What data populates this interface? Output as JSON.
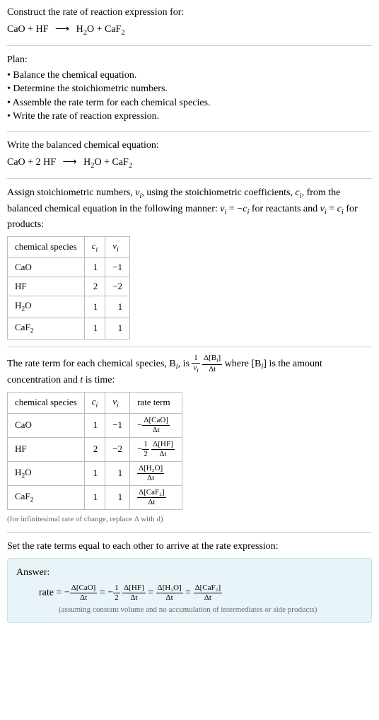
{
  "header": {
    "prompt": "Construct the rate of reaction expression for:",
    "reaction_lhs_1": "CaO",
    "reaction_lhs_2": "HF",
    "reaction_rhs_1_base": "H",
    "reaction_rhs_1_sub": "2",
    "reaction_rhs_1_tail": "O",
    "reaction_rhs_2_base": "CaF",
    "reaction_rhs_2_sub": "2"
  },
  "plan": {
    "label": "Plan:",
    "items": [
      "Balance the chemical equation.",
      "Determine the stoichiometric numbers.",
      "Assemble the rate term for each chemical species.",
      "Write the rate of reaction expression."
    ]
  },
  "balanced": {
    "intro": "Write the balanced chemical equation:",
    "lhs_1": "CaO",
    "lhs_2_coef": "2",
    "lhs_2": "HF",
    "rhs_1_base": "H",
    "rhs_1_sub": "2",
    "rhs_1_tail": "O",
    "rhs_2_base": "CaF",
    "rhs_2_sub": "2"
  },
  "stoich": {
    "intro_1": "Assign stoichiometric numbers, ",
    "nu_i": "ν",
    "i_sub": "i",
    "intro_2": ", using the stoichiometric coefficients, ",
    "c_i": "c",
    "intro_3": ", from the balanced chemical equation in the following manner: ",
    "rel1": " = −",
    "intro_4": " for reactants and ",
    "rel2": " = ",
    "intro_5": " for products:",
    "headers": {
      "species": "chemical species",
      "c": "c",
      "nu": "ν",
      "i": "i"
    },
    "rows": [
      {
        "species": "CaO",
        "c": "1",
        "nu": "−1"
      },
      {
        "species": "HF",
        "c": "2",
        "nu": "−2"
      },
      {
        "species_base": "H",
        "species_sub": "2",
        "species_tail": "O",
        "c": "1",
        "nu": "1"
      },
      {
        "species_base": "CaF",
        "species_sub": "2",
        "species_tail": "",
        "c": "1",
        "nu": "1"
      }
    ]
  },
  "rateterm": {
    "intro_1": "The rate term for each chemical species, B",
    "i_sub": "i",
    "intro_2": ", is ",
    "frac1_top": "1",
    "frac1_bot_nu": "ν",
    "frac2_top_delta": "Δ[B",
    "frac2_top_close": "]",
    "frac2_bot": "Δt",
    "intro_3": " where [B",
    "intro_4": "] is the amount concentration and ",
    "t": "t",
    "intro_5": " is time:",
    "headers": {
      "species": "chemical species",
      "c": "c",
      "nu": "ν",
      "i": "i",
      "rate": "rate term"
    },
    "rows": [
      {
        "species": "CaO",
        "c": "1",
        "nu": "−1",
        "neg": "−",
        "coef_top": "",
        "coef_bot": "",
        "top": "Δ[CaO]",
        "bot": "Δt"
      },
      {
        "species": "HF",
        "c": "2",
        "nu": "−2",
        "neg": "−",
        "coef_top": "1",
        "coef_bot": "2",
        "top": "Δ[HF]",
        "bot": "Δt"
      },
      {
        "species_base": "H",
        "species_sub": "2",
        "species_tail": "O",
        "c": "1",
        "nu": "1",
        "neg": "",
        "coef_top": "",
        "coef_bot": "",
        "top": "Δ[H₂O]",
        "bot": "Δt"
      },
      {
        "species_base": "CaF",
        "species_sub": "2",
        "species_tail": "",
        "c": "1",
        "nu": "1",
        "neg": "",
        "coef_top": "",
        "coef_bot": "",
        "top": "Δ[CaF₂]",
        "bot": "Δt"
      }
    ],
    "note": "(for infinitesimal rate of change, replace Δ with d)"
  },
  "final": {
    "intro": "Set the rate terms equal to each other to arrive at the rate expression:",
    "answer_label": "Answer:",
    "rate_label": "rate = ",
    "neg": "−",
    "t1_top": "Δ[CaO]",
    "t1_bot": "Δt",
    "eq": " = ",
    "half_top": "1",
    "half_bot": "2",
    "t2_top": "Δ[HF]",
    "t2_bot": "Δt",
    "t3_top": "Δ[H₂O]",
    "t3_bot": "Δt",
    "t4_top": "Δ[CaF₂]",
    "t4_bot": "Δt",
    "note": "(assuming constant volume and no accumulation of intermediates or side products)"
  },
  "chart_data": {
    "type": "table",
    "tables": [
      {
        "title": "stoichiometric numbers",
        "columns": [
          "chemical species",
          "c_i",
          "ν_i"
        ],
        "rows": [
          [
            "CaO",
            1,
            -1
          ],
          [
            "HF",
            2,
            -2
          ],
          [
            "H2O",
            1,
            1
          ],
          [
            "CaF2",
            1,
            1
          ]
        ]
      },
      {
        "title": "rate terms",
        "columns": [
          "chemical species",
          "c_i",
          "ν_i",
          "rate term"
        ],
        "rows": [
          [
            "CaO",
            1,
            -1,
            "-Δ[CaO]/Δt"
          ],
          [
            "HF",
            2,
            -2,
            "-(1/2)Δ[HF]/Δt"
          ],
          [
            "H2O",
            1,
            1,
            "Δ[H2O]/Δt"
          ],
          [
            "CaF2",
            1,
            1,
            "Δ[CaF2]/Δt"
          ]
        ]
      }
    ]
  }
}
